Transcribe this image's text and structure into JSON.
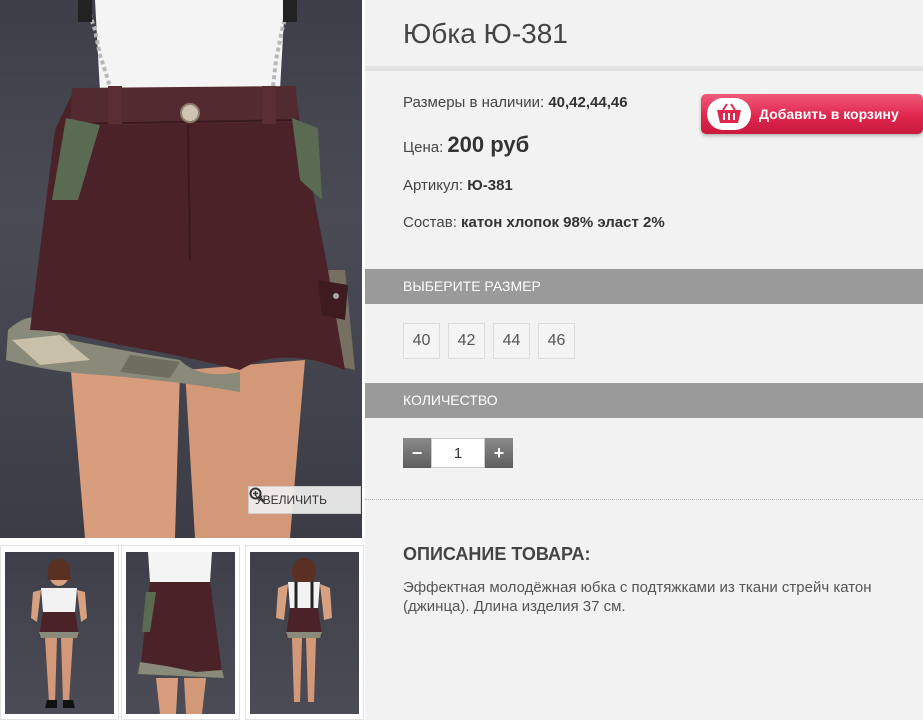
{
  "product": {
    "title": "Юбка Ю-381",
    "sizes_label": "Размеры в наличии: ",
    "sizes_value": "40,42,44,46",
    "price_label": "Цена: ",
    "price_value": "200 руб",
    "sku_label": "Артикул: ",
    "sku_value": "Ю-381",
    "composition_label": "Состав: ",
    "composition_value": "катон хлопок 98% эласт 2%"
  },
  "cart_button": {
    "label": "Добавить в корзину",
    "icon": "basket-icon",
    "color": "#e0264d"
  },
  "zoom_button": {
    "label": "УВЕЛИЧИТЬ",
    "icon": "zoom-in-icon"
  },
  "size_section": {
    "title": "ВЫБЕРИТЕ РАЗМЕР",
    "options": [
      "40",
      "42",
      "44",
      "46"
    ]
  },
  "quantity_section": {
    "title": "КОЛИЧЕСТВО",
    "minus": "−",
    "plus": "+",
    "value": "1"
  },
  "description": {
    "title": "ОПИСАНИЕ ТОВАРА:",
    "text": "Эффектная молодёжная юбка с подтяжками из ткани стрейч катон (джинца). Длина изделия 37 см."
  },
  "thumbnails": [
    "front-full-view",
    "front-skirt-view",
    "back-full-view"
  ],
  "colors": {
    "skirt": "#4a2227",
    "section_bar": "#9a9a9a",
    "panel_bg": "#f2f2f2"
  }
}
